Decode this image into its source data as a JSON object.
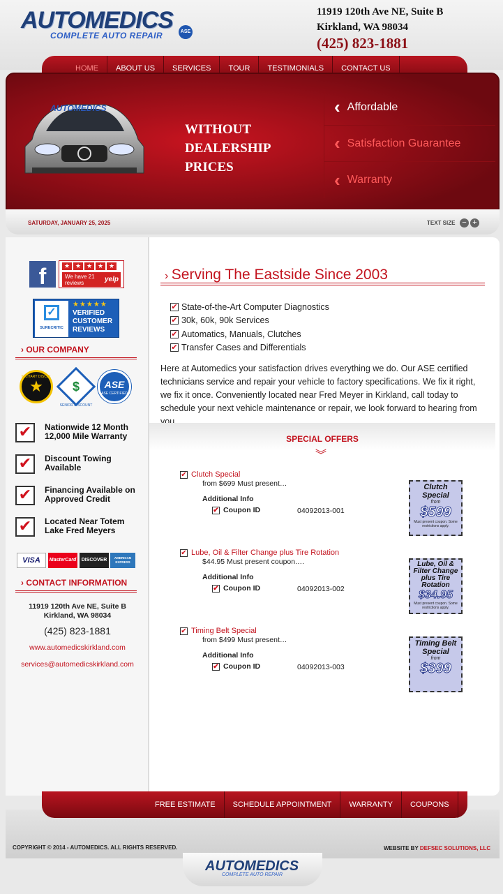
{
  "header": {
    "logo": "AUTOMEDICS",
    "logo_sub": "COMPLETE AUTO REPAIR",
    "ase": "ASE",
    "address1": "11919 120th Ave NE, Suite B",
    "address2": "Kirkland, WA 98034",
    "phone": "(425) 823-1881"
  },
  "nav": [
    "HOME",
    "ABOUT US",
    "SERVICES",
    "TOUR",
    "TESTIMONIALS",
    "CONTACT US"
  ],
  "hero": {
    "car_logo": "AUTOMEDICS",
    "line1": "WITHOUT",
    "line2": "DEALERSHIP",
    "line3": "PRICES",
    "tabs": [
      "Affordable",
      "Satisfaction Guarantee",
      "Warranty"
    ]
  },
  "datebar": {
    "date": "SATURDAY, JANUARY 25, 2025",
    "text_size": "TEXT SIZE"
  },
  "sidebar": {
    "yelp_line1": "We have 21",
    "yelp_line2": "reviews",
    "yelp": "yelp",
    "surecritic_verified": "VERIFIED",
    "surecritic_customer": "CUSTOMER",
    "surecritic_reviews": "REVIEWS",
    "surecritic_brand": "SURECRITIC",
    "our_company": "OUR COMPANY",
    "badge_military": "MILITARY DISCOUNT",
    "badge_senior": "SENIOR DISCOUNT",
    "badge_ase": "ASE CERTIFIED",
    "features": [
      "Nationwide 12 Month 12,000 Mile Warranty",
      "Discount Towing Available",
      "Financing Available on Approved Credit",
      "Located Near Totem Lake Fred Meyers"
    ],
    "cards": [
      "VISA",
      "MasterCard",
      "DISCOVER",
      "AMERICAN EXPRESS"
    ],
    "contact_head": "CONTACT INFORMATION",
    "address1": "11919 120th Ave NE, Suite B",
    "address2": "Kirkland, WA 98034",
    "phone": "(425) 823-1881",
    "website": "www.automedicskirkland.com",
    "email": "services@automedicskirkland.com"
  },
  "main": {
    "title": "Serving The Eastside Since 2003",
    "bullets": [
      "State-of-the-Art Computer Diagnostics",
      "30k, 60k, 90k Services",
      "Automatics, Manuals, Clutches",
      "Transfer Cases and Differentials"
    ],
    "intro": "Here at Automedics your satisfaction drives everything we do. Our ASE certified technicians service and repair your vehicle to factory specifications. We fix it right, we fix it once. Conveniently located near Fred Meyer in Kirkland, call today to schedule your next vehicle maintenance or repair, we look forward to hearing from you.",
    "offers_title": "SPECIAL OFFERS",
    "additional_info": "Additional Info",
    "coupon_id_label": "Coupon ID",
    "offers": [
      {
        "title": "Clutch Special",
        "desc": "from $699 Must present…",
        "coupon_id": "04092013-001",
        "coupon_title": "Clutch Special",
        "coupon_from": "from",
        "coupon_price": "$599",
        "coupon_note": "Must present coupon. Some restrictions apply."
      },
      {
        "title": "Lube, Oil & Filter Change plus Tire Rotation",
        "desc": "$44.95 Must present coupon.…",
        "coupon_id": "04092013-002",
        "coupon_title": "Lube, Oil & Filter Change plus Tire Rotation",
        "coupon_from": "",
        "coupon_price": "$34.95",
        "coupon_note": "Must present coupon. Some restrictions apply."
      },
      {
        "title": "Timing Belt Special",
        "desc": "from $499 Must present…",
        "coupon_id": "04092013-003",
        "coupon_title": "Timing Belt Special",
        "coupon_from": "from",
        "coupon_price": "$399",
        "coupon_note": ""
      }
    ]
  },
  "footer": {
    "nav": [
      "FREE ESTIMATE",
      "SCHEDULE APPOINTMENT",
      "WARRANTY",
      "COUPONS"
    ],
    "copyright": "COPYRIGHT © 2014 - AUTOMEDICS. ALL RIGHTS RESERVED.",
    "credit_prefix": "WEBSITE BY",
    "credit_link": "DEFSEC SOLUTIONS, LLC",
    "logo": "AUTOMEDICS",
    "logo_sub": "COMPLETE AUTO REPAIR"
  },
  "colors": {
    "brand_red": "#c3141f",
    "brand_blue": "#1f3f78",
    "dark_red": "#7a0910"
  }
}
